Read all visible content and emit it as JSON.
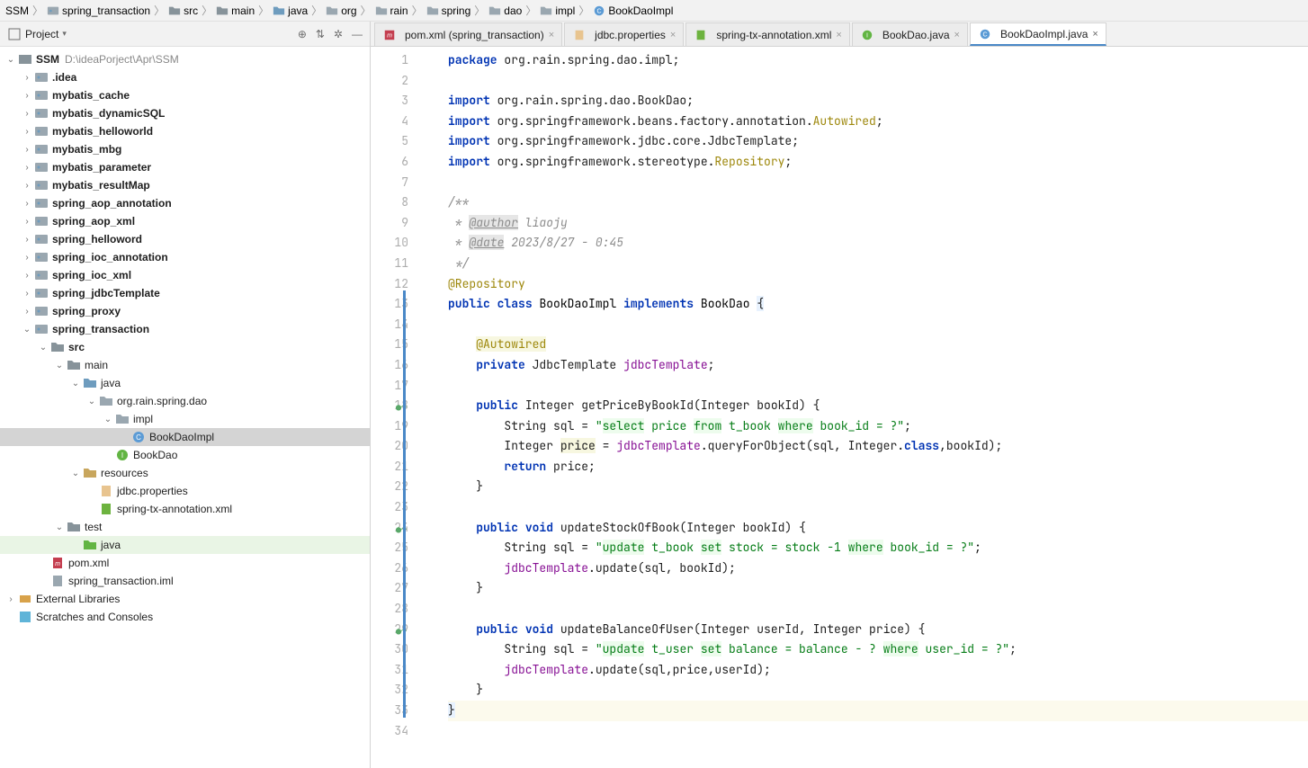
{
  "breadcrumb": [
    "SSM",
    "spring_transaction",
    "src",
    "main",
    "java",
    "org",
    "rain",
    "spring",
    "dao",
    "impl",
    "BookDaoImpl"
  ],
  "sidebar": {
    "title": "Project",
    "root": {
      "label": "SSM",
      "path": "D:\\ideaPorject\\Apr\\SSM"
    },
    "modules": [
      ".idea",
      "mybatis_cache",
      "mybatis_dynamicSQL",
      "mybatis_helloworld",
      "mybatis_mbg",
      "mybatis_parameter",
      "mybatis_resultMap",
      "spring_aop_annotation",
      "spring_aop_xml",
      "spring_helloword",
      "spring_ioc_annotation",
      "spring_ioc_xml",
      "spring_jdbcTemplate",
      "spring_proxy",
      "spring_transaction"
    ],
    "src_tree": {
      "src": "src",
      "main": "main",
      "java": "java",
      "pkg": "org.rain.spring.dao",
      "impl": "impl",
      "cls": "BookDaoImpl",
      "iface": "BookDao",
      "resources": "resources",
      "res1": "jdbc.properties",
      "res2": "spring-tx-annotation.xml",
      "test": "test",
      "test_java": "java",
      "pom": "pom.xml",
      "iml": "spring_transaction.iml"
    },
    "ext_lib": "External Libraries",
    "scratches": "Scratches and Consoles"
  },
  "tabs": [
    {
      "label": "pom.xml (spring_transaction)",
      "icon": "m"
    },
    {
      "label": "jdbc.properties",
      "icon": "prop"
    },
    {
      "label": "spring-tx-annotation.xml",
      "icon": "xml"
    },
    {
      "label": "BookDao.java",
      "icon": "iface"
    },
    {
      "label": "BookDaoImpl.java",
      "icon": "cls",
      "active": true
    }
  ],
  "code": {
    "lines": 34,
    "vcs": {
      "18": "add",
      "24": "add",
      "29": "add"
    }
  }
}
